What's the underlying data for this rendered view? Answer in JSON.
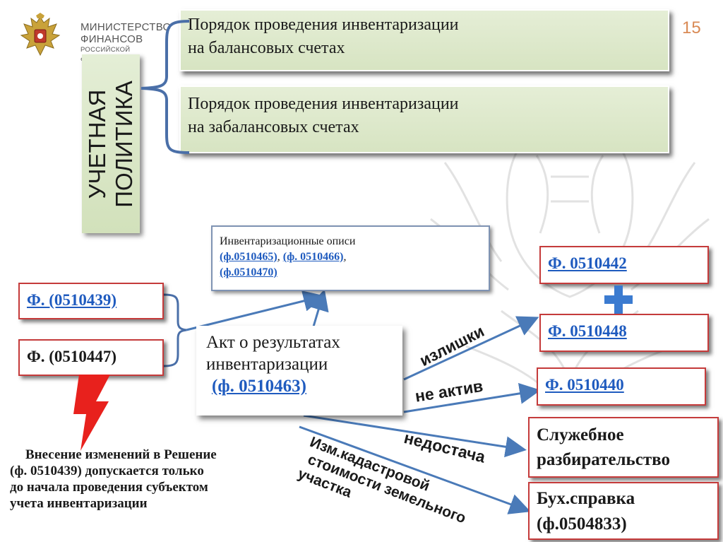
{
  "header": {
    "ministry_line1": "МИНИСТЕРСТВО",
    "ministry_line2": "ФИНАНСОВ",
    "ministry_line3": "РОССИЙСКОЙ ФЕДЕРАЦИИ",
    "slide_number": "15"
  },
  "policy": {
    "label_line1": "УЧЕТНАЯ",
    "label_line2": "ПОЛИТИКА",
    "box1_line1": "Порядок проведения инвентаризации",
    "box1_line2": "на балансовых счетах",
    "box2_line1": "Порядок проведения инвентаризации",
    "box2_line2": "на забалансовых счетах"
  },
  "inventory": {
    "title": "Инвентаризационные описи",
    "form1": "(ф.0510465)",
    "sep1": ", ",
    "form2": "(ф. 0510466)",
    "sep2": ",",
    "form3": "(ф.0510470)"
  },
  "left_forms": {
    "form439": "Ф. (0510439)",
    "form447": "Ф. (0510447)"
  },
  "act": {
    "line1": "Акт о результатах",
    "line2": "инвентаризации",
    "form": "(ф. 0510463)"
  },
  "outcomes": {
    "surplus": "излишки",
    "not_asset": "не актив",
    "shortage": "недостача",
    "cadastral_line1": "Изм.кадастровой",
    "cadastral_line2": "стоимости земельного",
    "cadastral_line3": "участка"
  },
  "right_forms": {
    "form442": "Ф. 0510442",
    "form448": "Ф. 0510448",
    "form440": "Ф. 0510440",
    "investigation_line1": "Служебное",
    "investigation_line2": "разбирательство",
    "certificate_line1": "Бух.справка",
    "certificate_line2": "(ф.0504833)"
  },
  "note": {
    "line1": "Внесение изменений в Решение",
    "line2": "(ф. 0510439) допускается только",
    "line3": "до начала проведения субъектом",
    "line4": "учета инвентаризации"
  },
  "colors": {
    "green_box": "#dae6c7",
    "red_border": "#c53b3b",
    "link_blue": "#1f5bbf",
    "arrow_blue": "#4a7ab8",
    "bracket_blue": "#4a6fa8",
    "plus_blue": "#3b7bd0",
    "lightning_red": "#e8211d",
    "slide_number": "#d98a55"
  }
}
